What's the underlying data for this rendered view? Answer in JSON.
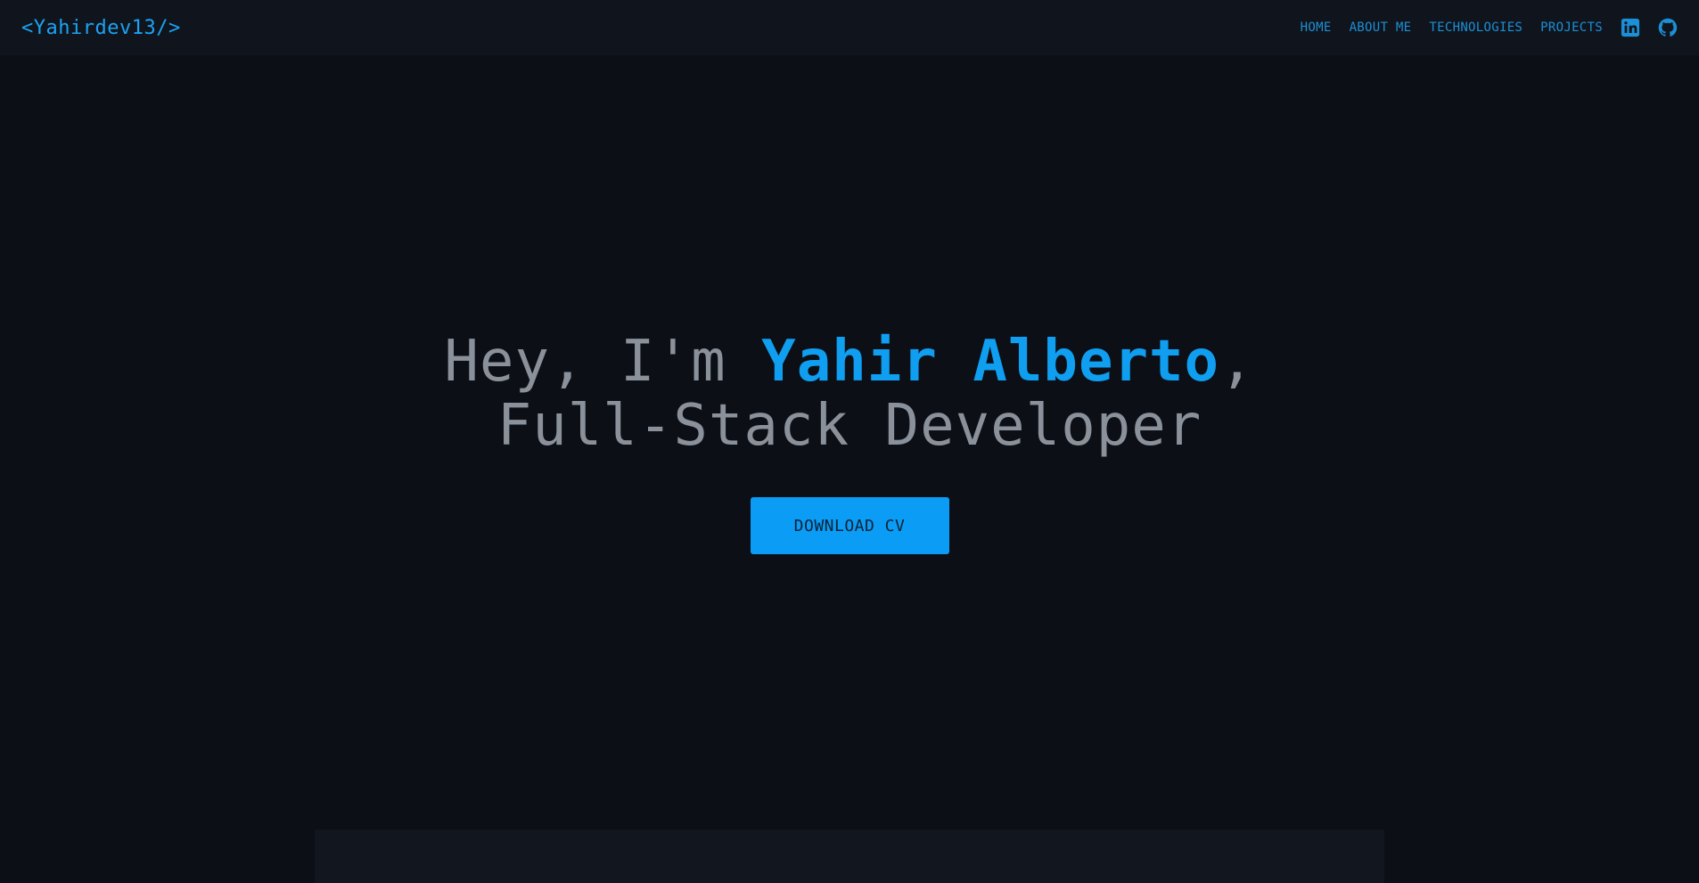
{
  "navbar": {
    "brand": "<Yahirdev13/>",
    "links": [
      {
        "label": "HOME"
      },
      {
        "label": "ABOUT ME"
      },
      {
        "label": "TECHNOLOGIES"
      },
      {
        "label": "PROJECTS"
      }
    ],
    "social": [
      {
        "icon": "linkedin-icon"
      },
      {
        "icon": "github-icon"
      }
    ]
  },
  "hero": {
    "greeting": "Hey, I'm ",
    "name": "Yahir Alberto",
    "role": ", Full-Stack Developer",
    "cta_label": "DOWNLOAD CV"
  },
  "colors": {
    "background": "#0c0f16",
    "navbar": "#10151d",
    "accent": "#0f9ef0",
    "text_muted": "#8a919a",
    "button": "#0b9df6"
  }
}
